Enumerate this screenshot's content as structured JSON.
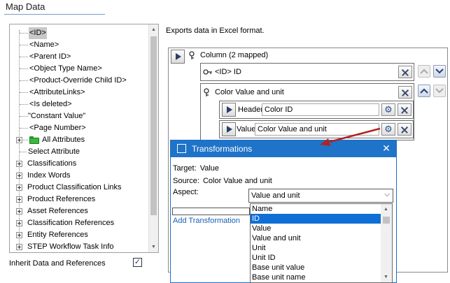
{
  "header": {
    "title": "Map Data"
  },
  "tree": {
    "items": [
      {
        "label": "<ID>",
        "selected": true
      },
      {
        "label": "<Name>"
      },
      {
        "label": "<Parent ID>"
      },
      {
        "label": "<Object Type Name>"
      },
      {
        "label": "<Product-Override Child ID>"
      },
      {
        "label": "<AttributeLinks>"
      },
      {
        "label": "<Is deleted>"
      },
      {
        "label": "\"Constant Value\""
      },
      {
        "label": "<Page Number>"
      },
      {
        "label": "All Attributes",
        "icon": "folder-icon",
        "icon_color": "#3cb83c"
      },
      {
        "label": "Select Attribute"
      },
      {
        "label": "Classifications"
      },
      {
        "label": "Index Words"
      },
      {
        "label": "Product Classification Links"
      },
      {
        "label": "Product References"
      },
      {
        "label": "Asset References"
      },
      {
        "label": "Classification References"
      },
      {
        "label": "Entity References"
      },
      {
        "label": "STEP Workflow Task Info"
      }
    ]
  },
  "inherit": {
    "label": "Inherit Data and References",
    "checked": true
  },
  "description": "Exports data in Excel format.",
  "mapping": {
    "column_label": "Column (2 mapped)",
    "id_row_label": "<ID> ID",
    "color_row_label": "Color Value and unit",
    "header_label": "Header",
    "header_value": "Color ID",
    "value_label": "Value",
    "value_value": "Color Value and unit"
  },
  "dialog": {
    "title": "Transformations",
    "target_label": "Target:",
    "target_value": "Value",
    "source_label": "Source:",
    "source_value": "Color Value and unit",
    "aspect_label": "Aspect:",
    "aspect_selected": "Value and unit",
    "add_link": "Add Transformation",
    "accent_color": "#1f73c9"
  },
  "aspect_options": [
    "Name",
    "ID",
    "Value",
    "Value and unit",
    "Unit",
    "Unit ID",
    "Base unit value",
    "Base unit name"
  ],
  "aspect_highlighted": "ID",
  "annotation": {
    "arrow_color": "#b22222"
  }
}
